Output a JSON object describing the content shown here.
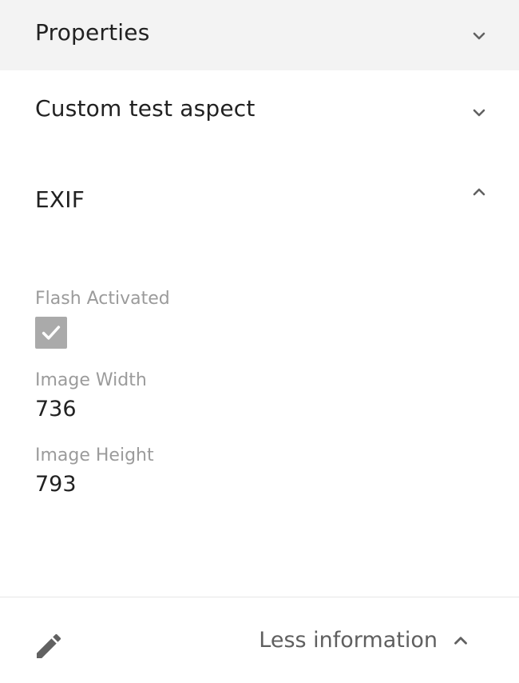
{
  "sections": {
    "properties": {
      "title": "Properties",
      "expanded": false,
      "icon": "chevron-down-icon"
    },
    "custom": {
      "title": "Custom test aspect",
      "expanded": false,
      "icon": "chevron-down-icon"
    },
    "exif": {
      "title": "EXIF",
      "expanded": true,
      "icon": "chevron-up-icon"
    }
  },
  "exif_fields": {
    "flash": {
      "label": "Flash Activated",
      "checked": true
    },
    "width": {
      "label": "Image Width",
      "value": "736"
    },
    "height": {
      "label": "Image Height",
      "value": "793"
    }
  },
  "footer": {
    "edit_icon": "pencil-icon",
    "less_info_label": "Less information",
    "less_info_icon": "chevron-up-icon"
  },
  "colors": {
    "header_bg": "#f3f3f3",
    "label_gray": "#9b9b9b",
    "checkbox_gray": "#aaaaaa",
    "icon_gray": "#616161"
  }
}
